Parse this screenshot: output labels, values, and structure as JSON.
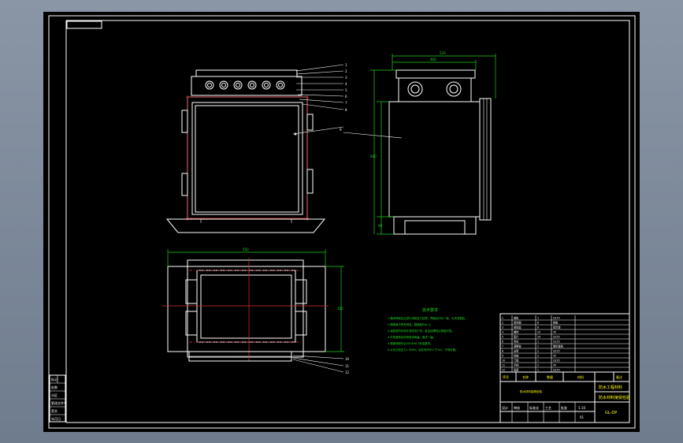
{
  "title_block": {
    "title_yellow": "防水工程材料",
    "title_green": "防水材料接受检验",
    "scale": "1:10",
    "sheet_no": "01",
    "drawing_code": "GL-DP",
    "role_labels": [
      "设计",
      "审核",
      "标准化",
      "工艺",
      "批准"
    ],
    "header_cells": [
      "序号",
      "名称",
      "数量",
      "材料",
      "备注"
    ],
    "parts_rows": [
      [
        "1",
        "盖板",
        "1",
        "Q235"
      ],
      [
        "2",
        "密封圈",
        "6",
        "橡胶"
      ],
      [
        "3",
        "接线盒",
        "6",
        "铝合金"
      ],
      [
        "4",
        "螺栓",
        "24",
        "45"
      ],
      [
        "5",
        "垫片",
        "24",
        "Q235"
      ],
      [
        "6",
        "壳体",
        "1",
        "Q235"
      ],
      [
        "7",
        "观察窗",
        "1",
        "钢化玻璃"
      ],
      [
        "8",
        "支架",
        "2",
        "Q235"
      ],
      [
        "9",
        "铰链",
        "2",
        "45"
      ],
      [
        "10",
        "门框",
        "1",
        "Q235"
      ],
      [
        "11",
        "手柄",
        "2",
        "45"
      ],
      [
        "12",
        "底座",
        "1",
        "Q235"
      ]
    ]
  },
  "notes": {
    "heading": "技术要求",
    "lines": [
      "1.箱体焊接后应进行消除应力处理，焊缝应均匀一致，无夹渣裂纹。",
      "2.隔爆面不得有锈蚀，粗糙度Ra6.3。",
      "3.装配前所有零件须清洗干净，各连接螺栓应紧固可靠。",
      "4.外表面喷涂防锈底漆两遍，面漆一遍。",
      "5.隔爆间隙符合GB3836.2标准要求。",
      "6.水压试验压力1.0MPa，保压时间不少于10s，不得渗漏。"
    ]
  },
  "dimensions": {
    "side_width_overall": "520",
    "side_width_inner": "460",
    "side_height": "600",
    "side_base": "90",
    "top_width": "560",
    "top_depth": "420"
  },
  "balloons": [
    "1",
    "2",
    "3",
    "4",
    "5",
    "6",
    "7",
    "8",
    "9",
    "10",
    "11",
    "12"
  ],
  "left_strip": [
    "标记",
    "处数",
    "分区",
    "更改文件号",
    "签名",
    "年月日"
  ],
  "colors": {
    "background": "#000000",
    "frame": "#ffffff",
    "dimension": "#20d020",
    "centerline": "#e03030",
    "title_text": "#ffff00"
  }
}
